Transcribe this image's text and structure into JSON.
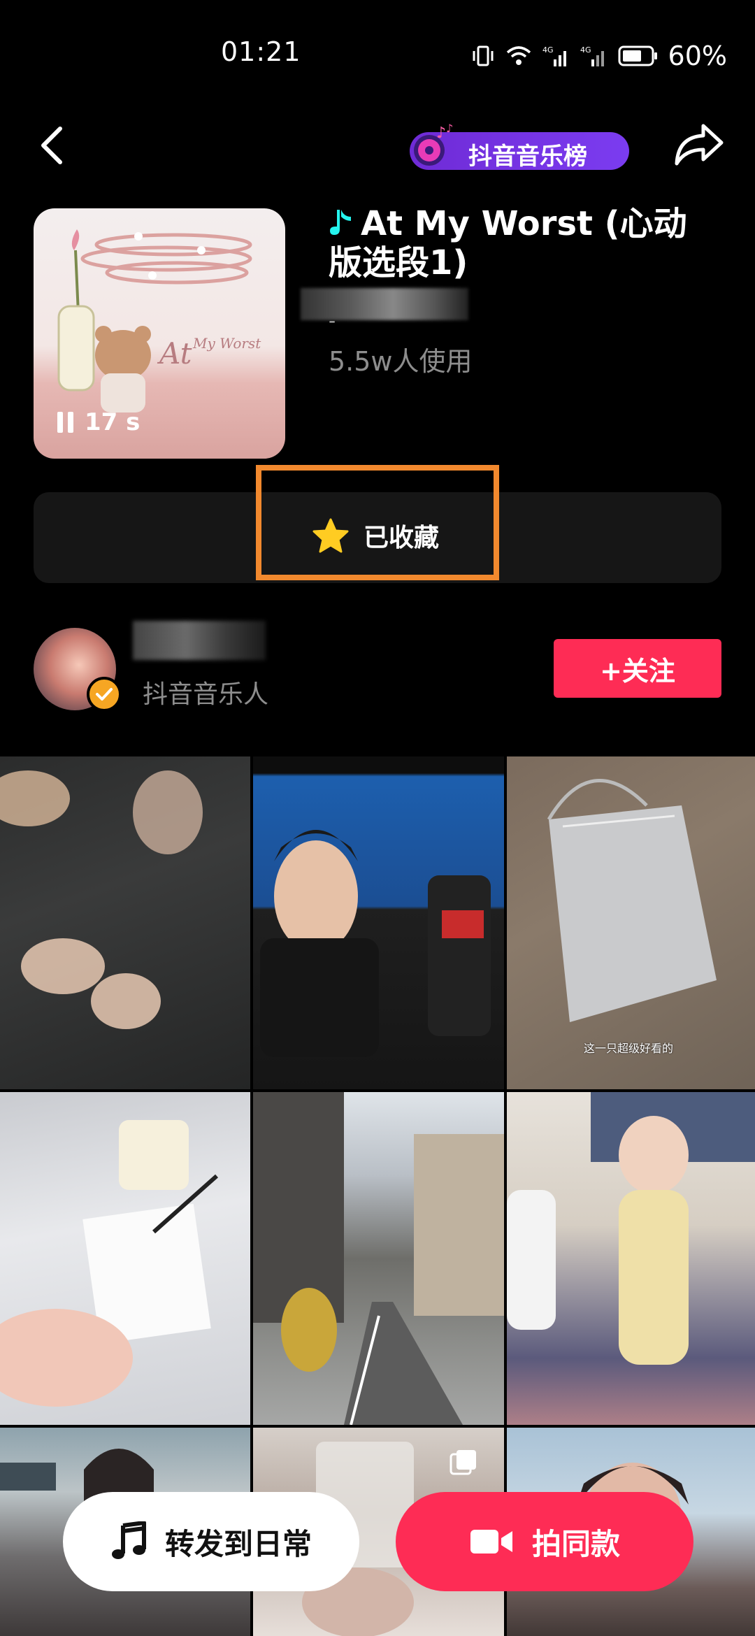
{
  "status_bar": {
    "time": "01:21",
    "battery": "60%",
    "network_1": "4G",
    "network_2": "4G"
  },
  "header": {
    "chart_badge": "抖音音乐榜"
  },
  "music": {
    "title": "At My Worst (心动版选段1)",
    "artist_line": "-",
    "usage": "5.5w人使用",
    "duration": "17 s",
    "cover_text": "At My Worst"
  },
  "favorite": {
    "label": "已收藏",
    "highlight_color": "#f2892e",
    "star_color": "#ffcc22"
  },
  "creator": {
    "role": "抖音音乐人",
    "follow_label": "+关注"
  },
  "grid": {
    "caption_3": "这一只超级好看的"
  },
  "bottom": {
    "repost_label": "转发到日常",
    "shoot_label": "拍同款"
  },
  "colors": {
    "accent": "#fe2c55",
    "badge": "#7b3cf0",
    "verified": "#f6a623"
  }
}
